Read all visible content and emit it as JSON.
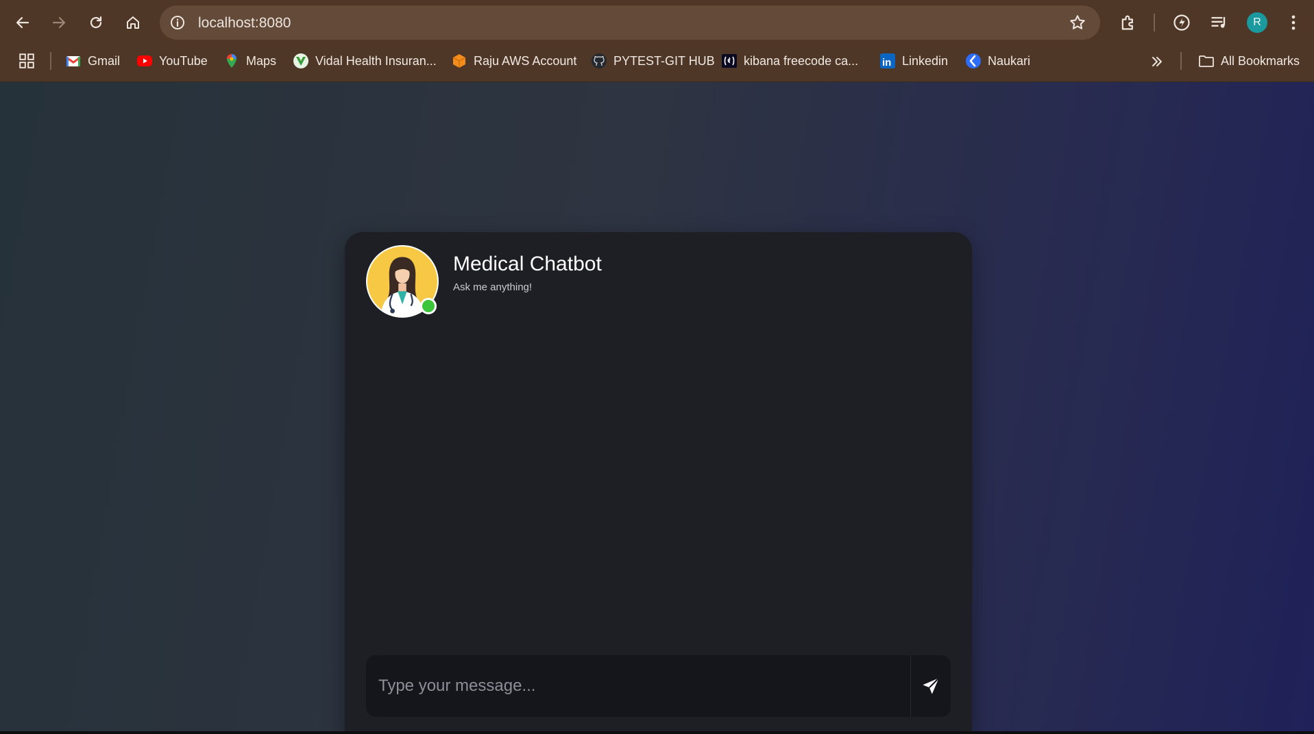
{
  "browser": {
    "url": "localhost:8080",
    "profile_initial": "R",
    "bookmarks": [
      {
        "label": "Gmail",
        "icon": "gmail-icon"
      },
      {
        "label": "YouTube",
        "icon": "youtube-icon"
      },
      {
        "label": "Maps",
        "icon": "maps-icon"
      },
      {
        "label": "Vidal Health Insuran...",
        "icon": "vidal-health-icon"
      },
      {
        "label": "Raju AWS Account",
        "icon": "aws-cube-icon"
      },
      {
        "label": "PYTEST-GIT HUB",
        "icon": "github-icon"
      },
      {
        "label": "kibana freecode ca...",
        "icon": "freecodecamp-icon"
      },
      {
        "label": "Linkedin",
        "icon": "linkedin-icon"
      },
      {
        "label": "Naukari",
        "icon": "naukri-icon"
      }
    ],
    "all_bookmarks_label": "All Bookmarks"
  },
  "chat": {
    "title": "Medical Chatbot",
    "subtitle": "Ask me anything!",
    "input_placeholder": "Type your message...",
    "input_value": "",
    "status": "online",
    "status_color": "#3cc43a",
    "avatar_bg_color": "#f6c843"
  }
}
